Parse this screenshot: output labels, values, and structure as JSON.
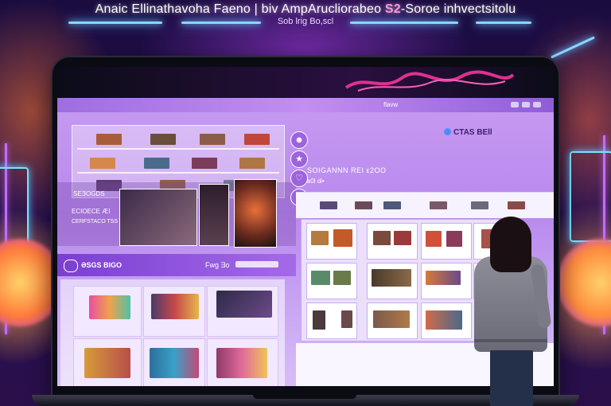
{
  "banner": {
    "headline_main": "Anaic Ellinathavoha Faeno | biv AmpArucliorabeo ",
    "headline_accent": "S2",
    "headline_tail": "-Soroe inhvectsitolu",
    "subline": "Sob lrig Bo,scl"
  },
  "screen": {
    "titlebar_label": "flavw",
    "brand_name": "CTAS BEll",
    "search_title": "SOIGANNN  REI   ε2OO",
    "search_sub": "ʙ0l di•",
    "section_label": "ƏSGS BIGO",
    "section_mid": "Fwg Ǝo",
    "promo_title": "SEƎOGDS",
    "promo_line1": "ECIOECE ÆI",
    "promo_line2": "CERFSTACO TSS ILN"
  },
  "icons": {
    "side": [
      "user-icon",
      "tag-icon",
      "heart-icon",
      "filter-icon"
    ]
  },
  "colors": {
    "screen_purple": "#c79af0",
    "neon_blue": "#8ad6ff",
    "neon_pink": "#c46bff",
    "accent_pink": "#ff9ad8"
  }
}
